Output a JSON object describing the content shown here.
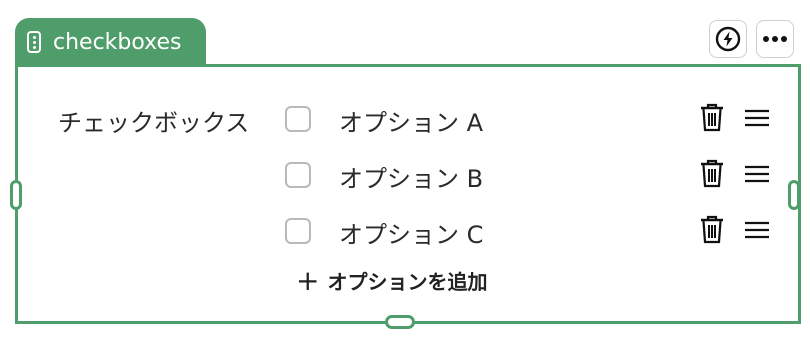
{
  "block": {
    "tab_label": "checkboxes",
    "accent_color": "#4e9d6a"
  },
  "toolbar": {
    "lightning_icon": "lightning-bolt-circle-icon",
    "more_icon": "more-horizontal-icon"
  },
  "field": {
    "label": "チェックボックス",
    "options": [
      {
        "label": "オプション A",
        "checked": false
      },
      {
        "label": "オプション B",
        "checked": false
      },
      {
        "label": "オプション C",
        "checked": false
      }
    ],
    "add_option_label": "オプションを追加"
  }
}
